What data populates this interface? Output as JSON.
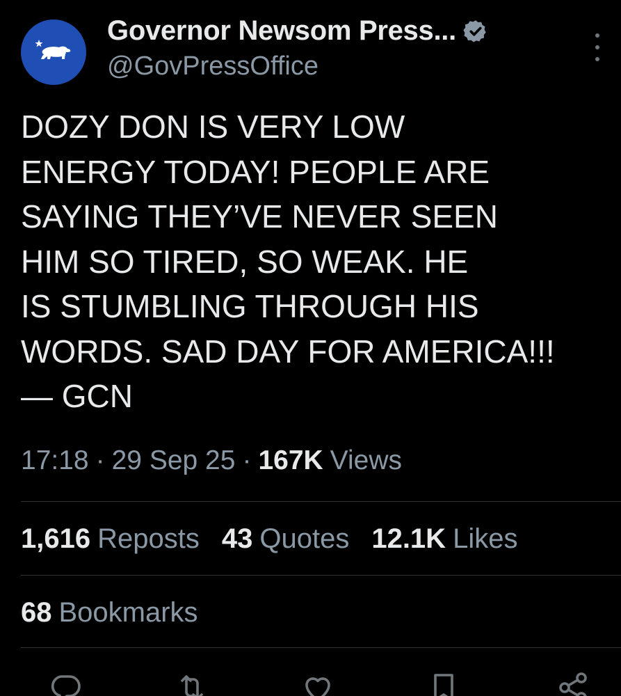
{
  "account": {
    "display_name": "Governor Newsom Press...",
    "handle": "@GovPressOffice",
    "verified": true,
    "avatar_color": "#1f4fb4"
  },
  "tweet": {
    "text": "DOZY DON IS VERY LOW\nENERGY TODAY! PEOPLE ARE\nSAYING THEY’VE NEVER SEEN\nHIM SO TIRED, SO WEAK. HE\nIS STUMBLING THROUGH HIS\nWORDS. SAD DAY FOR AMERICA!!!\n— GCN",
    "time": "17:18",
    "date": "29 Sep 25",
    "separator": "·",
    "views_count": "167K",
    "views_label": "Views"
  },
  "stats": {
    "reposts_count": "1,616",
    "reposts_label": "Reposts",
    "quotes_count": "43",
    "quotes_label": "Quotes",
    "likes_count": "12.1K",
    "likes_label": "Likes",
    "bookmarks_count": "68",
    "bookmarks_label": "Bookmarks"
  },
  "actions": [
    "reply-icon",
    "repost-icon",
    "like-icon",
    "bookmark-icon",
    "share-icon"
  ],
  "colors": {
    "background": "#000000",
    "text": "#e7e9ea",
    "secondary": "#8b98a5",
    "divider": "#2f3336",
    "verified_badge": "#8b98a5"
  }
}
